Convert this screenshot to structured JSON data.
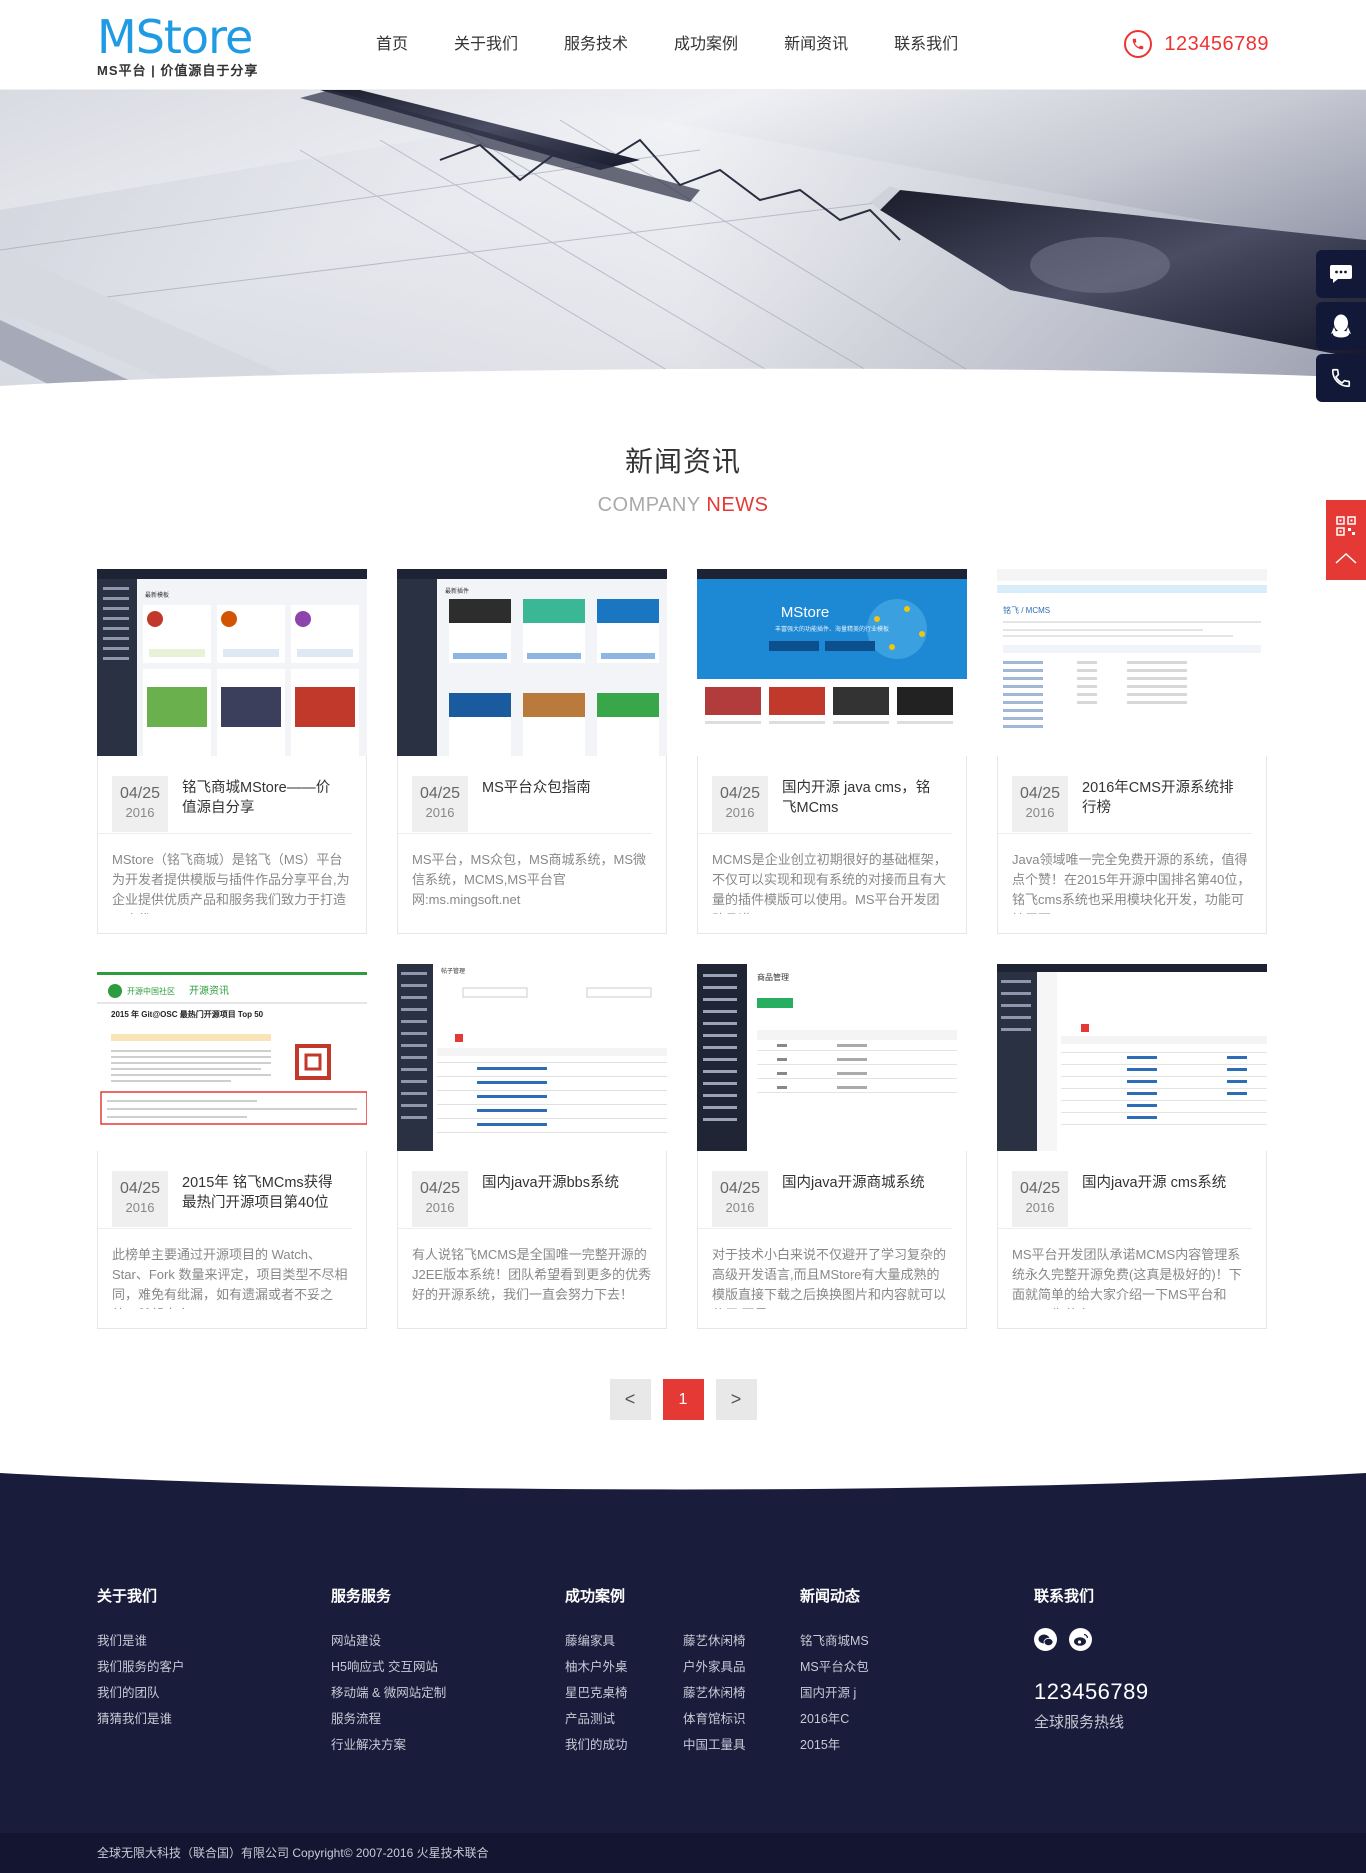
{
  "brand": {
    "logo": "MStore",
    "tagline": "MS平台 | 价值源自于分享",
    "accent": "#1f9be3",
    "red": "#e53935",
    "navy": "#1a1c3b"
  },
  "nav": [
    "首页",
    "关于我们",
    "服务技术",
    "成功案例",
    "新闻资讯",
    "联系我们"
  ],
  "header": {
    "phone": "123456789",
    "phone_icon": "phone-icon"
  },
  "side_float": {
    "icons": [
      "chat-icon",
      "qq-icon",
      "phone-icon"
    ],
    "red_icons": [
      "qrcode-icon",
      "arrow-up-icon"
    ]
  },
  "news": {
    "title": "新闻资讯",
    "sub_gray": "COMPANY",
    "sub_red": "NEWS",
    "items": [
      {
        "md": "04/25",
        "year": "2016",
        "title": "铭飞商城MStore——价值源自分享",
        "desc": "MStore（铭飞商城）是铭飞（MS）平台为开发者提供模版与插件作品分享平台,为企业提供优质产品和服务我们致力于打造一个优..."
      },
      {
        "md": "04/25",
        "year": "2016",
        "title": "MS平台众包指南",
        "desc": "MS平台，MS众包，MS商城系统，MS微信系统，MCMS,MS平台官网:ms.mingsoft.net"
      },
      {
        "md": "04/25",
        "year": "2016",
        "title": "国内开源 java cms，铭飞MCms",
        "desc": "MCMS是企业创立初期很好的基础框架，不仅可以实现和现有系统的对接而且有大量的插件模版可以使用。MS平台开发团队承诺..."
      },
      {
        "md": "04/25",
        "year": "2016",
        "title": "2016年CMS开源系统排行榜",
        "desc": "Java领域唯一完全免费开源的系统，值得点个赞！在2015年开源中国排名第40位，铭飞cms系统也采用模块化开发，功能可扩展更..."
      },
      {
        "md": "04/25",
        "year": "2016",
        "title": "2015年 铭飞MCms获得最热门开源项目第40位",
        "desc": "此榜单主要通过开源项目的 Watch、Star、Fork 数量来评定，项目类型不尽相同，难免有纰漏，如有遗漏或者不妥之处，希望大家..."
      },
      {
        "md": "04/25",
        "year": "2016",
        "title": "国内java开源bbs系统",
        "desc": "有人说铭飞MCMS是全国唯一完整开源的J2EE版本系统！团队希望看到更多的优秀好的开源系统，我们一直会努力下去！"
      },
      {
        "md": "04/25",
        "year": "2016",
        "title": "国内java开源商城系统",
        "desc": "对于技术小白来说不仅避开了学习复杂的高级开发语言,而且MStore有大量成熟的模版直接下载之后换换图片和内容就可以使用,要是..."
      },
      {
        "md": "04/25",
        "year": "2016",
        "title": "国内java开源 cms系统",
        "desc": "MS平台开发团队承诺MCMS内容管理系统永久完整开源免费(这真是极好的)！下面就简单的给大家介绍一下MS平台和MCMS为什么..."
      }
    ]
  },
  "thumbs": {
    "t3_title": "MStore",
    "t3_sub": "丰富强大的功能插件、海量精美的行业模板",
    "t4_path": "铭飞 / MCMS",
    "t5_heading": "2015 年 Git@OSC 最热门开源项目 Top 50",
    "t5_site": "开源中国社区",
    "t5_section": "开源资讯",
    "t6_title": "帖子管理",
    "t7_title": "商品管理",
    "t2_title": "最新插件",
    "t1_title": "最新模板"
  },
  "pager": {
    "prev": "<",
    "current": "1",
    "next": ">"
  },
  "footer": {
    "cols": [
      {
        "title": "关于我们",
        "items": [
          "我们是谁",
          "我们服务的客户",
          "我们的团队",
          "猜猜我们是谁"
        ]
      },
      {
        "title": "服务服务",
        "items": [
          "网站建设",
          "H5响应式 交互网站",
          "移动端 & 微网站定制",
          "服务流程",
          "行业解决方案"
        ]
      },
      {
        "title": "成功案例",
        "items": [
          "藤编家具",
          "柚木户外桌",
          "星巴克桌椅",
          "产品测试",
          "我们的成功"
        ],
        "items2": [
          "藤艺休闲椅",
          "户外家具品",
          "藤艺休闲椅",
          "体育馆标识",
          "中国工量具"
        ]
      },
      {
        "title": "新闻动态",
        "items": [
          "铭飞商城MS",
          "MS平台众包",
          "国内开源 j",
          "2016年C",
          "2015年"
        ]
      }
    ],
    "contact_title": "联系我们",
    "social_icons": [
      "wechat-icon",
      "weibo-icon"
    ],
    "hotline": "123456789",
    "hotline_label": "全球服务热线",
    "copyright": "全球无限大科技（联合国）有限公司 Copyright© 2007-2016 火星技术联合"
  }
}
